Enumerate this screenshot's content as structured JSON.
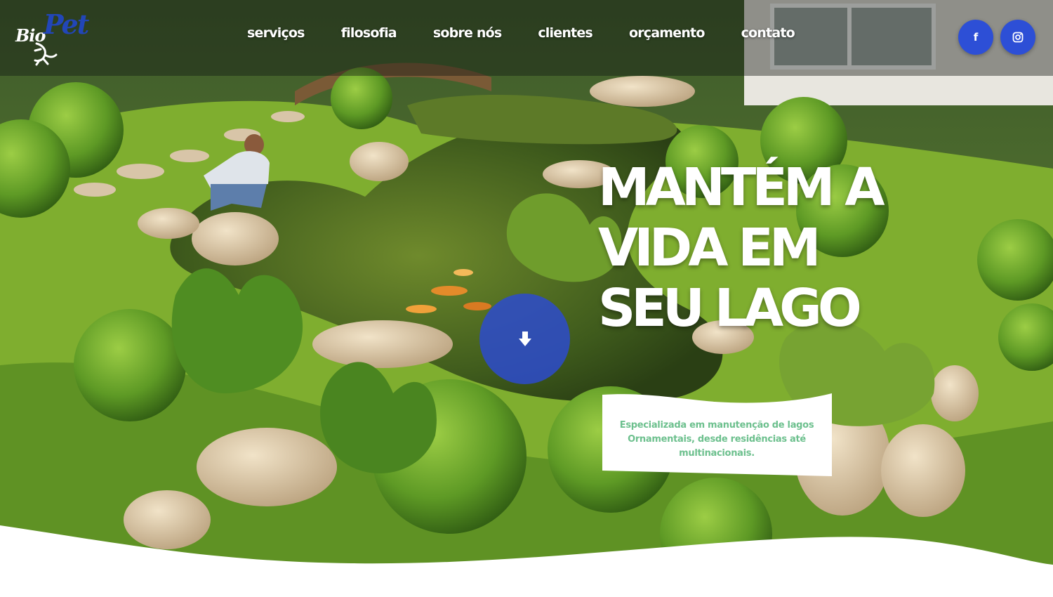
{
  "brand": {
    "logo_part1": "Bio",
    "logo_part2": "Pet",
    "accent_color": "#2d4fd6"
  },
  "nav": {
    "items": [
      {
        "label": "serviços"
      },
      {
        "label": "filosofia"
      },
      {
        "label": "sobre nós"
      },
      {
        "label": "clientes"
      },
      {
        "label": "orçamento"
      },
      {
        "label": "contato"
      }
    ]
  },
  "social": {
    "facebook_label": "f",
    "facebook_icon": "facebook-icon",
    "instagram_icon": "instagram-icon"
  },
  "hero": {
    "headline_lines": [
      "MANTÉM A",
      "VIDA EM",
      "SEU LAGO"
    ],
    "scroll_icon": "arrow-down-icon",
    "description": "Especializada em manutenção de lagos Ornamentais, desde residências até multinacionais.",
    "description_color": "#6dc08e"
  }
}
